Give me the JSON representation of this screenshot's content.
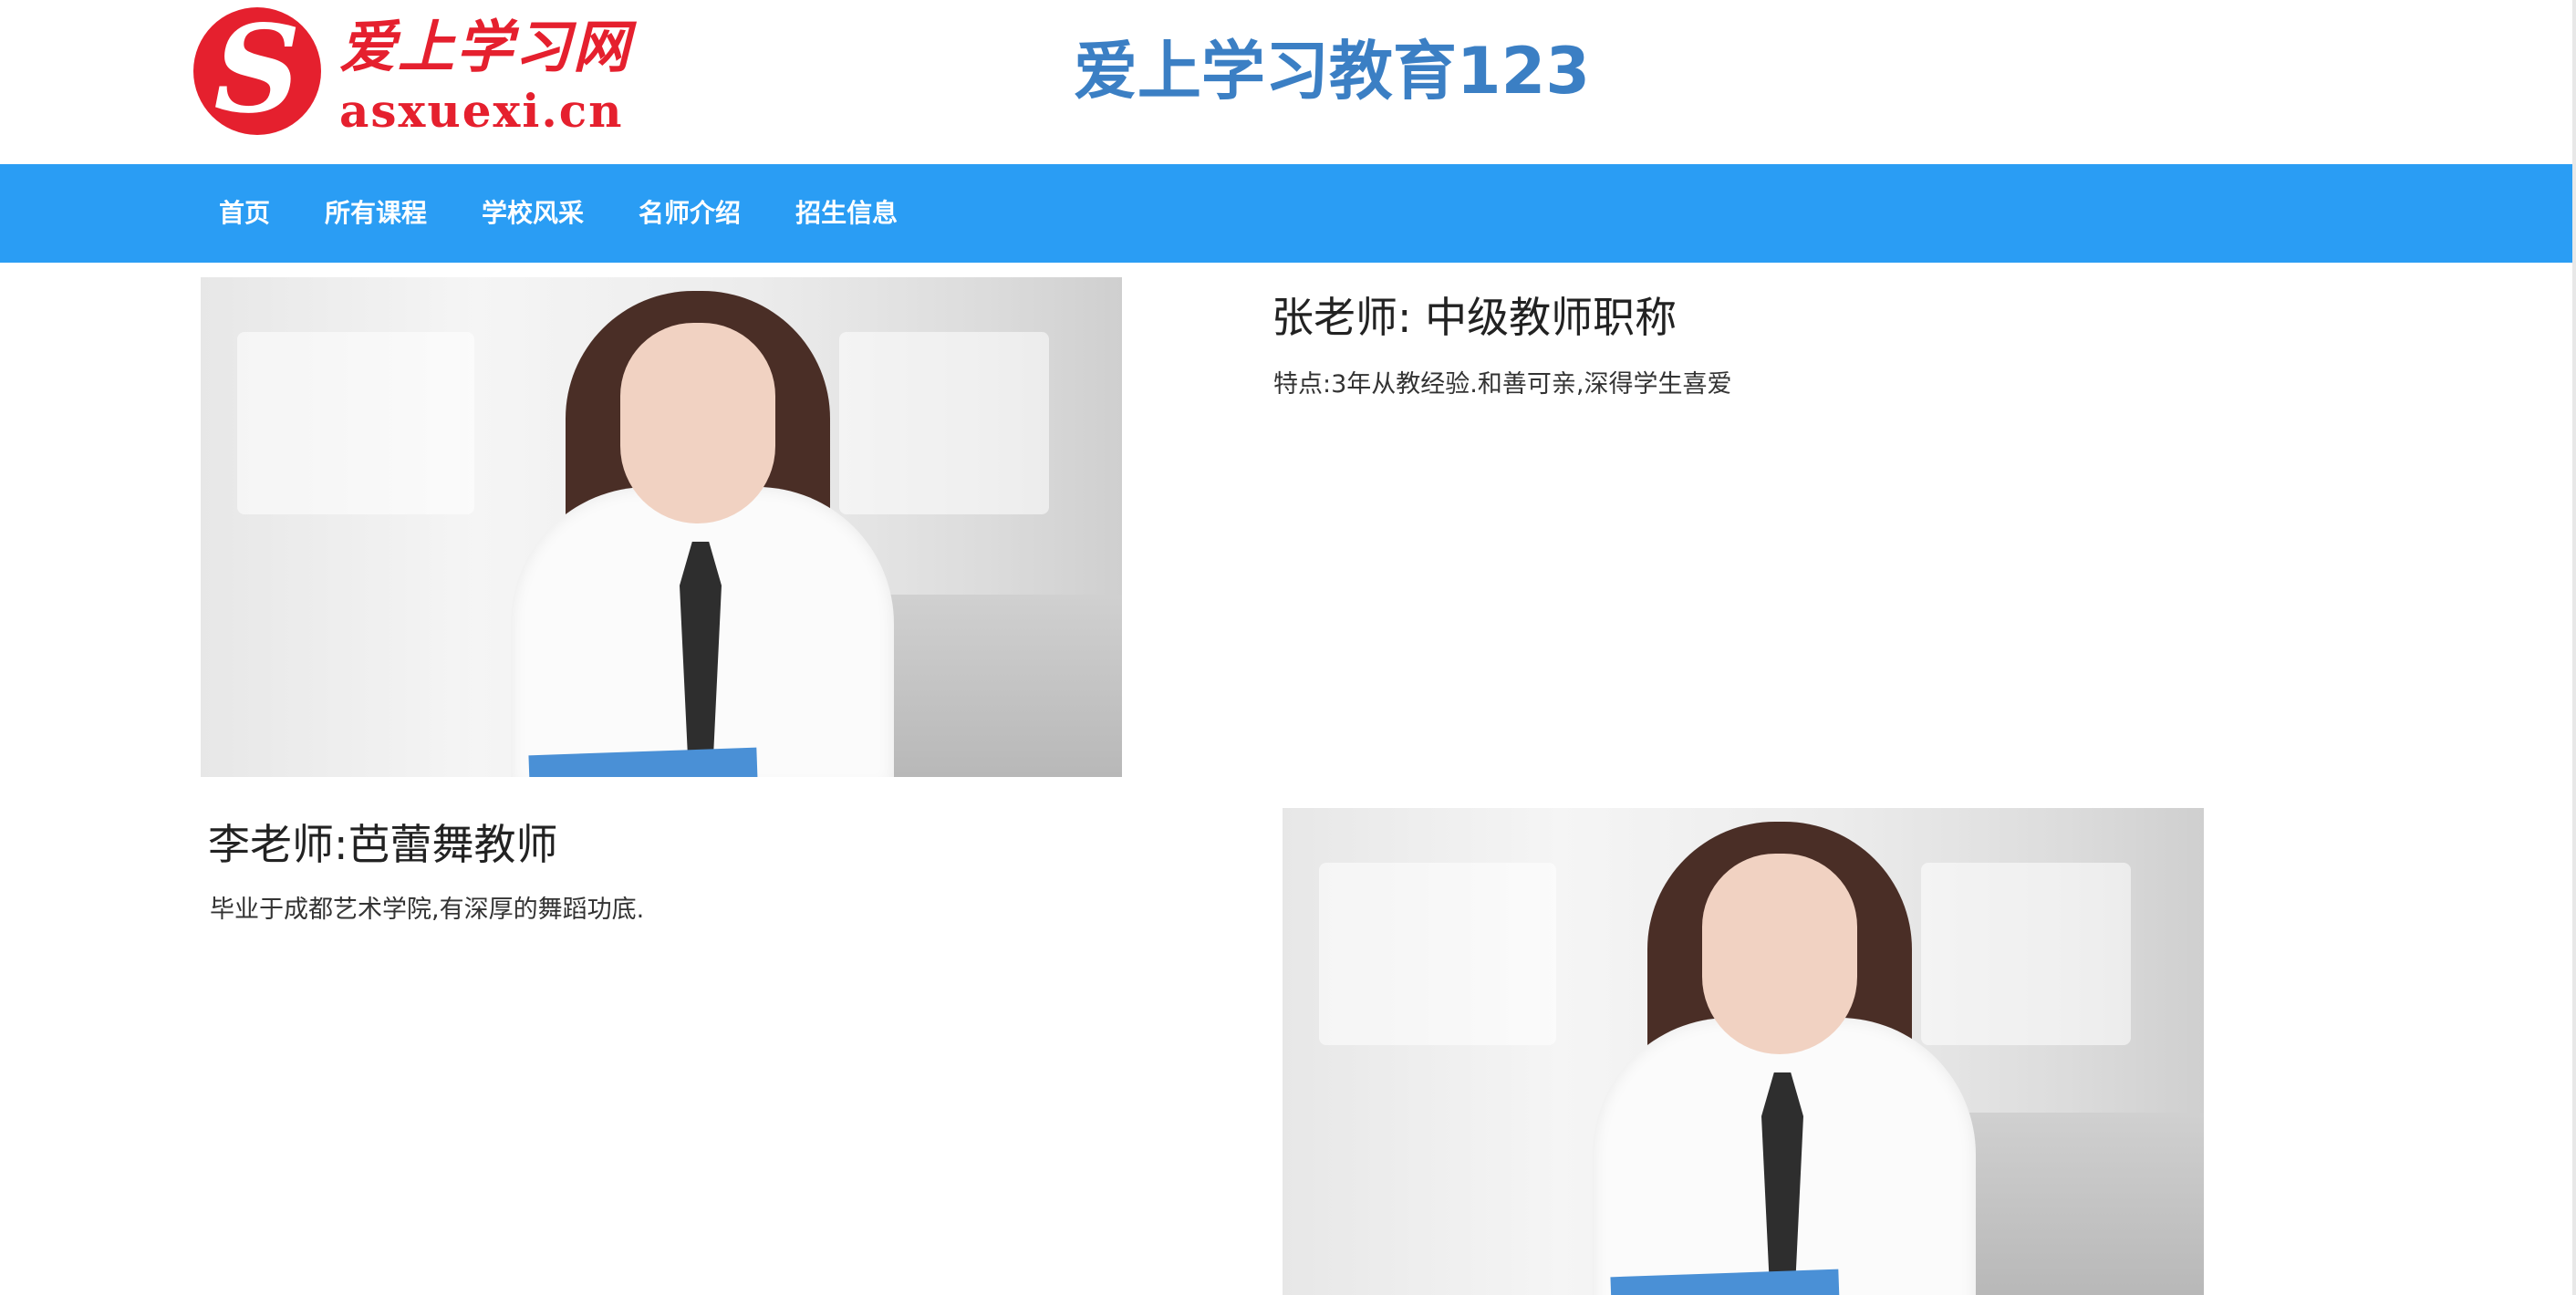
{
  "header": {
    "logo_badge_letter": "S",
    "logo_text_cn": "爱上学习网",
    "logo_text_en": "asxuexi.cn",
    "site_title": "爱上学习教育123"
  },
  "nav": {
    "items": [
      {
        "label": "首页"
      },
      {
        "label": "所有课程"
      },
      {
        "label": "学校风采"
      },
      {
        "label": "名师介绍"
      },
      {
        "label": "招生信息"
      }
    ]
  },
  "teachers": [
    {
      "name": "张老师: 中级教师职称",
      "desc": "特点:3年从教经验.和善可亲,深得学生喜爱"
    },
    {
      "name": "李老师:芭蕾舞教师",
      "desc": "毕业于成都艺术学院,有深厚的舞蹈功底."
    }
  ],
  "colors": {
    "nav_bg": "#2a9df4",
    "title_blue": "#3b7fc4",
    "logo_red": "#e5202e"
  }
}
